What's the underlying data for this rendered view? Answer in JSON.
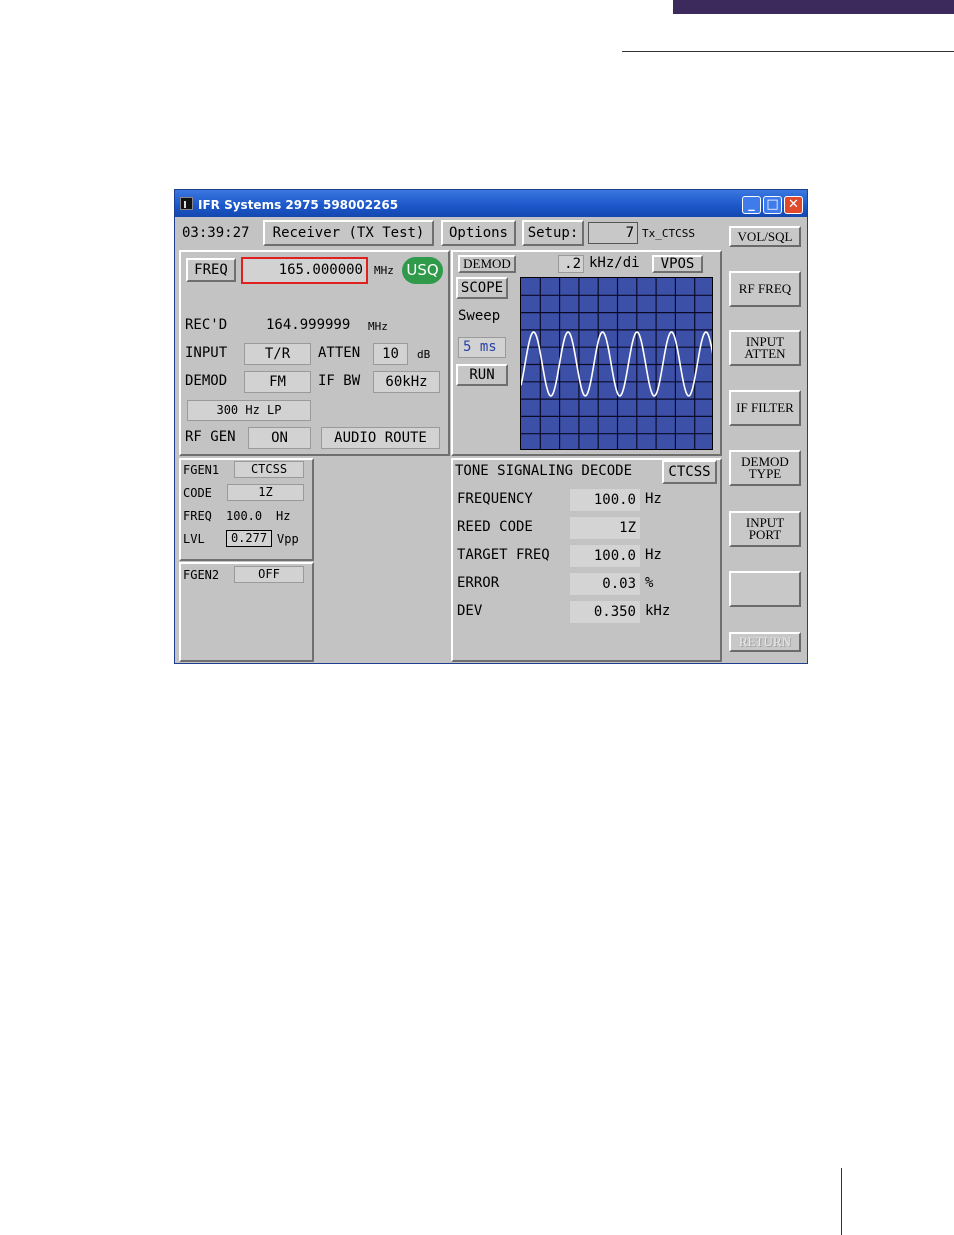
{
  "window": {
    "title": "IFR Systems 2975 598002265",
    "minimize_glyph": "_",
    "maximize_glyph": "□",
    "close_glyph": "✕"
  },
  "topstrip": {
    "time": "03:39:27",
    "mode": "Receiver (TX Test)",
    "options": "Options",
    "setup": "Setup:",
    "setup_value": "7",
    "setup_name": "Tx_CTCSS"
  },
  "receiver": {
    "freq_label": "FREQ",
    "freq_value": "165.000000",
    "freq_unit": "MHz",
    "usq_badge": "USQ",
    "recd_label": "REC'D",
    "recd_value": "164.999999",
    "recd_unit": "MHz",
    "input_label": "INPUT",
    "input_value": "T/R",
    "atten_label": "ATTEN",
    "atten_value": "10",
    "atten_unit": "dB",
    "demod_label": "DEMOD",
    "demod_value": "FM",
    "ifbw_label": "IF BW",
    "ifbw_value": "60kHz",
    "filter_value": "300 Hz LP",
    "rfgen_label": "RF GEN",
    "rfgen_value": "ON",
    "audio_route": "AUDIO ROUTE"
  },
  "scope": {
    "demod_tab": "DEMOD",
    "scale_value": ".2",
    "scale_unit": "kHz/di",
    "vpos": "VPOS",
    "mode": "SCOPE",
    "sweep_label": "Sweep",
    "sweep_value": "5 ms",
    "run": "RUN"
  },
  "fgen1": {
    "label": "FGEN1",
    "type": "CTCSS",
    "code_label": "CODE",
    "code_value": "1Z",
    "freq_label": "FREQ",
    "freq_value": "100.0",
    "freq_unit": "Hz",
    "lvl_label": "LVL",
    "lvl_value": "0.277",
    "lvl_unit": "Vpp"
  },
  "fgen2": {
    "label": "FGEN2",
    "value": "OFF"
  },
  "decode": {
    "title": "TONE SIGNALING DECODE",
    "type": "CTCSS",
    "rows": [
      {
        "label": "FREQUENCY",
        "value": "100.0",
        "unit": "Hz"
      },
      {
        "label": "REED CODE",
        "value": "1Z",
        "unit": ""
      },
      {
        "label": "TARGET FREQ",
        "value": "100.0",
        "unit": "Hz"
      },
      {
        "label": "ERROR",
        "value": "0.03",
        "unit": "%"
      },
      {
        "label": "DEV",
        "value": "0.350",
        "unit": "kHz"
      }
    ]
  },
  "softkeys": [
    "VOL/SQL",
    "RF FREQ",
    "INPUT\nATTEN",
    "IF FILTER",
    "DEMOD\nTYPE",
    "INPUT\nPORT",
    "",
    "RETURN"
  ],
  "colors": {
    "usq_badge": "#2e9a4a",
    "freq_highlight": "#e0201e",
    "scope_bg": "#3d50a8",
    "trace": "#ffffff",
    "header_bar": "#3d2a5c"
  }
}
